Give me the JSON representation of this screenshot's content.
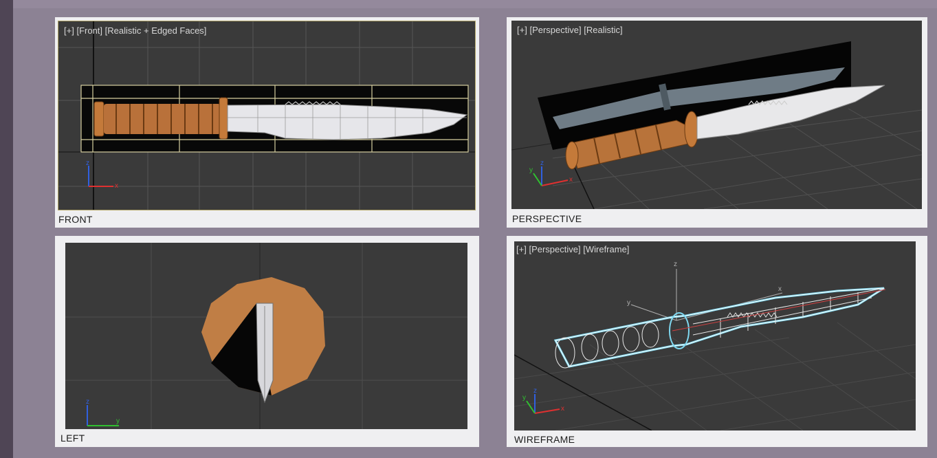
{
  "viewports": {
    "front": {
      "caption": "FRONT",
      "label": {
        "plus": "[+]",
        "view": "[Front]",
        "mode": "[Realistic + Edged Faces]"
      },
      "axes": {
        "z": "z",
        "x": "x"
      }
    },
    "perspective": {
      "caption": "PERSPECTIVE",
      "label": {
        "plus": "[+]",
        "view": "[Perspective]",
        "mode": "[Realistic]"
      },
      "axes": {
        "z": "z",
        "x": "x",
        "y": "y"
      }
    },
    "left": {
      "caption": "LEFT",
      "axes": {
        "z": "z",
        "y": "y"
      }
    },
    "wireframe": {
      "caption": "WIREFRAME",
      "label": {
        "plus": "[+]",
        "view": "[Perspective]",
        "mode": "[Wireframe]"
      },
      "axes": {
        "z": "z",
        "x": "x",
        "y": "y"
      },
      "gizmo": {
        "z": "z",
        "y": "y",
        "x": "x"
      }
    }
  },
  "colors": {
    "viewport_bg": "#3a3a3a",
    "grid": "#555555",
    "handle": "#b8733a",
    "blade": "#e8e8ea",
    "selection_outline": "#d8d0a0",
    "wire_highlight": "#7fd8f0",
    "axis_x": "#e03030",
    "axis_y": "#30c030",
    "axis_z": "#3060e0"
  }
}
